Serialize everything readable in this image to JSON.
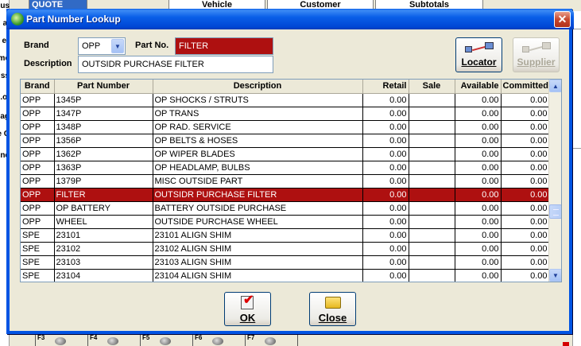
{
  "background": {
    "tabs": [
      "QUOTE",
      "Vehicle",
      "Customer",
      "Subtotals"
    ],
    "left_labels": [
      "us",
      "al",
      "er",
      "me",
      "ss",
      "ol.",
      "ag",
      "e C",
      "ne"
    ],
    "fkeys": [
      "F3",
      "F4",
      "F5",
      "F6",
      "F7"
    ]
  },
  "dialog": {
    "title": "Part Number Lookup",
    "close_glyph": "✕",
    "brand_label": "Brand",
    "brand_value": "OPP",
    "part_no_label": "Part No.",
    "part_no_value": "FILTER",
    "description_label": "Description",
    "description_value": "OUTSIDR PURCHASE FILTER",
    "locator_label": "Locator",
    "supplier_label": "Supplier",
    "ok_label": "OK",
    "close_label": "Close"
  },
  "grid": {
    "columns": [
      "Brand",
      "Part Number",
      "Description",
      "Retail",
      "Sale",
      "Available",
      "Committed"
    ],
    "rows": [
      [
        "OPP",
        "1345P",
        "OP SHOCKS / STRUTS",
        "0.00",
        "",
        "0.00",
        "0.00"
      ],
      [
        "OPP",
        "1347P",
        "OP TRANS",
        "0.00",
        "",
        "0.00",
        "0.00"
      ],
      [
        "OPP",
        "1348P",
        "OP RAD. SERVICE",
        "0.00",
        "",
        "0.00",
        "0.00"
      ],
      [
        "OPP",
        "1356P",
        "OP BELTS & HOSES",
        "0.00",
        "",
        "0.00",
        "0.00"
      ],
      [
        "OPP",
        "1362P",
        "OP WIPER BLADES",
        "0.00",
        "",
        "0.00",
        "0.00"
      ],
      [
        "OPP",
        "1363P",
        "OP HEADLAMP, BULBS",
        "0.00",
        "",
        "0.00",
        "0.00"
      ],
      [
        "OPP",
        "1379P",
        "MISC OUTSIDE PART",
        "0.00",
        "",
        "0.00",
        "0.00"
      ],
      [
        "OPP",
        "FILTER",
        "OUTSIDR PURCHASE FILTER",
        "0.00",
        "",
        "0.00",
        "0.00"
      ],
      [
        "OPP",
        "OP BATTERY",
        "BATTERY OUTSIDE PURCHASE",
        "0.00",
        "",
        "0.00",
        "0.00"
      ],
      [
        "OPP",
        "WHEEL",
        "OUTSIDE PURCHASE WHEEL",
        "0.00",
        "",
        "0.00",
        "0.00"
      ],
      [
        "SPE",
        "23101",
        "23101 ALIGN SHIM",
        "0.00",
        "",
        "0.00",
        "0.00"
      ],
      [
        "SPE",
        "23102",
        "23102 ALIGN SHIM",
        "0.00",
        "",
        "0.00",
        "0.00"
      ],
      [
        "SPE",
        "23103",
        "23103 ALIGN SHIM",
        "0.00",
        "",
        "0.00",
        "0.00"
      ],
      [
        "SPE",
        "23104",
        "23104 ALIGN SHIM",
        "0.00",
        "",
        "0.00",
        "0.00"
      ]
    ],
    "selected_index": 7
  },
  "colors": {
    "selection": "#ae1010",
    "titlebar": "#0a5fe8"
  }
}
